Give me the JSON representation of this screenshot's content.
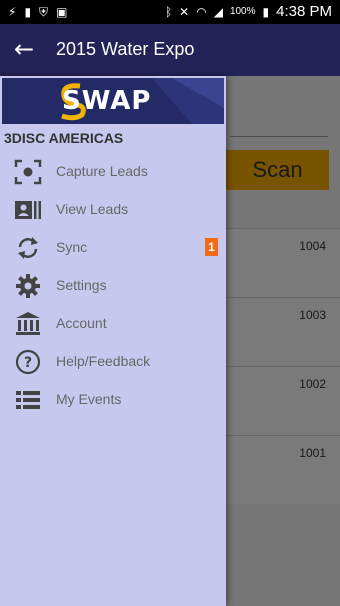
{
  "status_bar": {
    "battery_percent": "100%",
    "time": "4:38 PM",
    "icons": [
      "usb-icon",
      "battery-icon",
      "shield-icon",
      "image-icon",
      "bluetooth-icon",
      "mute-icon",
      "wifi-icon",
      "signal-icon"
    ]
  },
  "app_bar": {
    "title": "2015 Water Expo",
    "back_icon": "arrow-back-icon"
  },
  "content": {
    "scan_label": "Scan",
    "rows": [
      {
        "id": "1004"
      },
      {
        "id": "1003"
      },
      {
        "id": "1002"
      },
      {
        "id": "1001"
      }
    ]
  },
  "drawer": {
    "logo_text": "SWAP",
    "company": "3DISC AMERICAS",
    "items": [
      {
        "label": "Capture Leads",
        "icon": "capture-icon"
      },
      {
        "label": "View Leads",
        "icon": "contact-card-icon"
      },
      {
        "label": "Sync",
        "icon": "sync-icon",
        "badge": "1"
      },
      {
        "label": "Settings",
        "icon": "gear-icon"
      },
      {
        "label": "Account",
        "icon": "bank-icon"
      },
      {
        "label": "Help/Feedback",
        "icon": "help-icon"
      },
      {
        "label": "My Events",
        "icon": "list-icon"
      }
    ]
  },
  "colors": {
    "app_bar": "#232357",
    "drawer_bg": "#c8c8ef",
    "scan_button": "#f0a800",
    "badge": "#f26a13",
    "logo_bg": "#232a66"
  }
}
